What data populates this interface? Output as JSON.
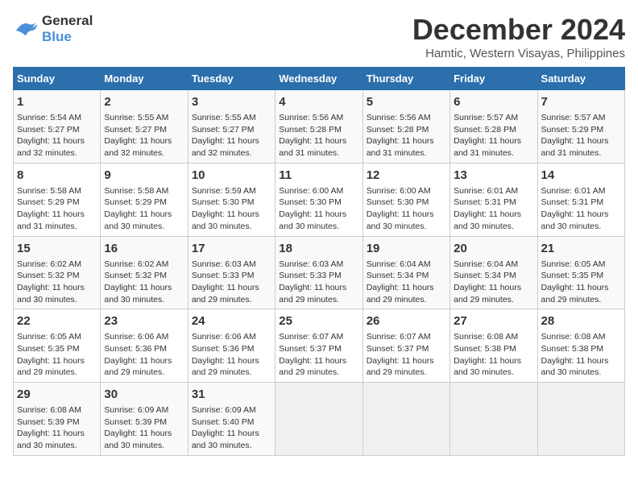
{
  "logo": {
    "line1": "General",
    "line2": "Blue"
  },
  "title": "December 2024",
  "subtitle": "Hamtic, Western Visayas, Philippines",
  "days_of_week": [
    "Sunday",
    "Monday",
    "Tuesday",
    "Wednesday",
    "Thursday",
    "Friday",
    "Saturday"
  ],
  "weeks": [
    [
      {
        "day": "1",
        "sunrise": "5:54 AM",
        "sunset": "5:27 PM",
        "daylight": "11 hours and 32 minutes."
      },
      {
        "day": "2",
        "sunrise": "5:55 AM",
        "sunset": "5:27 PM",
        "daylight": "11 hours and 32 minutes."
      },
      {
        "day": "3",
        "sunrise": "5:55 AM",
        "sunset": "5:27 PM",
        "daylight": "11 hours and 32 minutes."
      },
      {
        "day": "4",
        "sunrise": "5:56 AM",
        "sunset": "5:28 PM",
        "daylight": "11 hours and 31 minutes."
      },
      {
        "day": "5",
        "sunrise": "5:56 AM",
        "sunset": "5:28 PM",
        "daylight": "11 hours and 31 minutes."
      },
      {
        "day": "6",
        "sunrise": "5:57 AM",
        "sunset": "5:28 PM",
        "daylight": "11 hours and 31 minutes."
      },
      {
        "day": "7",
        "sunrise": "5:57 AM",
        "sunset": "5:29 PM",
        "daylight": "11 hours and 31 minutes."
      }
    ],
    [
      {
        "day": "8",
        "sunrise": "5:58 AM",
        "sunset": "5:29 PM",
        "daylight": "11 hours and 31 minutes."
      },
      {
        "day": "9",
        "sunrise": "5:58 AM",
        "sunset": "5:29 PM",
        "daylight": "11 hours and 30 minutes."
      },
      {
        "day": "10",
        "sunrise": "5:59 AM",
        "sunset": "5:30 PM",
        "daylight": "11 hours and 30 minutes."
      },
      {
        "day": "11",
        "sunrise": "6:00 AM",
        "sunset": "5:30 PM",
        "daylight": "11 hours and 30 minutes."
      },
      {
        "day": "12",
        "sunrise": "6:00 AM",
        "sunset": "5:30 PM",
        "daylight": "11 hours and 30 minutes."
      },
      {
        "day": "13",
        "sunrise": "6:01 AM",
        "sunset": "5:31 PM",
        "daylight": "11 hours and 30 minutes."
      },
      {
        "day": "14",
        "sunrise": "6:01 AM",
        "sunset": "5:31 PM",
        "daylight": "11 hours and 30 minutes."
      }
    ],
    [
      {
        "day": "15",
        "sunrise": "6:02 AM",
        "sunset": "5:32 PM",
        "daylight": "11 hours and 30 minutes."
      },
      {
        "day": "16",
        "sunrise": "6:02 AM",
        "sunset": "5:32 PM",
        "daylight": "11 hours and 30 minutes."
      },
      {
        "day": "17",
        "sunrise": "6:03 AM",
        "sunset": "5:33 PM",
        "daylight": "11 hours and 29 minutes."
      },
      {
        "day": "18",
        "sunrise": "6:03 AM",
        "sunset": "5:33 PM",
        "daylight": "11 hours and 29 minutes."
      },
      {
        "day": "19",
        "sunrise": "6:04 AM",
        "sunset": "5:34 PM",
        "daylight": "11 hours and 29 minutes."
      },
      {
        "day": "20",
        "sunrise": "6:04 AM",
        "sunset": "5:34 PM",
        "daylight": "11 hours and 29 minutes."
      },
      {
        "day": "21",
        "sunrise": "6:05 AM",
        "sunset": "5:35 PM",
        "daylight": "11 hours and 29 minutes."
      }
    ],
    [
      {
        "day": "22",
        "sunrise": "6:05 AM",
        "sunset": "5:35 PM",
        "daylight": "11 hours and 29 minutes."
      },
      {
        "day": "23",
        "sunrise": "6:06 AM",
        "sunset": "5:36 PM",
        "daylight": "11 hours and 29 minutes."
      },
      {
        "day": "24",
        "sunrise": "6:06 AM",
        "sunset": "5:36 PM",
        "daylight": "11 hours and 29 minutes."
      },
      {
        "day": "25",
        "sunrise": "6:07 AM",
        "sunset": "5:37 PM",
        "daylight": "11 hours and 29 minutes."
      },
      {
        "day": "26",
        "sunrise": "6:07 AM",
        "sunset": "5:37 PM",
        "daylight": "11 hours and 29 minutes."
      },
      {
        "day": "27",
        "sunrise": "6:08 AM",
        "sunset": "5:38 PM",
        "daylight": "11 hours and 30 minutes."
      },
      {
        "day": "28",
        "sunrise": "6:08 AM",
        "sunset": "5:38 PM",
        "daylight": "11 hours and 30 minutes."
      }
    ],
    [
      {
        "day": "29",
        "sunrise": "6:08 AM",
        "sunset": "5:39 PM",
        "daylight": "11 hours and 30 minutes."
      },
      {
        "day": "30",
        "sunrise": "6:09 AM",
        "sunset": "5:39 PM",
        "daylight": "11 hours and 30 minutes."
      },
      {
        "day": "31",
        "sunrise": "6:09 AM",
        "sunset": "5:40 PM",
        "daylight": "11 hours and 30 minutes."
      },
      null,
      null,
      null,
      null
    ]
  ],
  "labels": {
    "sunrise_prefix": "Sunrise: ",
    "sunset_prefix": "Sunset: ",
    "daylight_prefix": "Daylight: "
  }
}
